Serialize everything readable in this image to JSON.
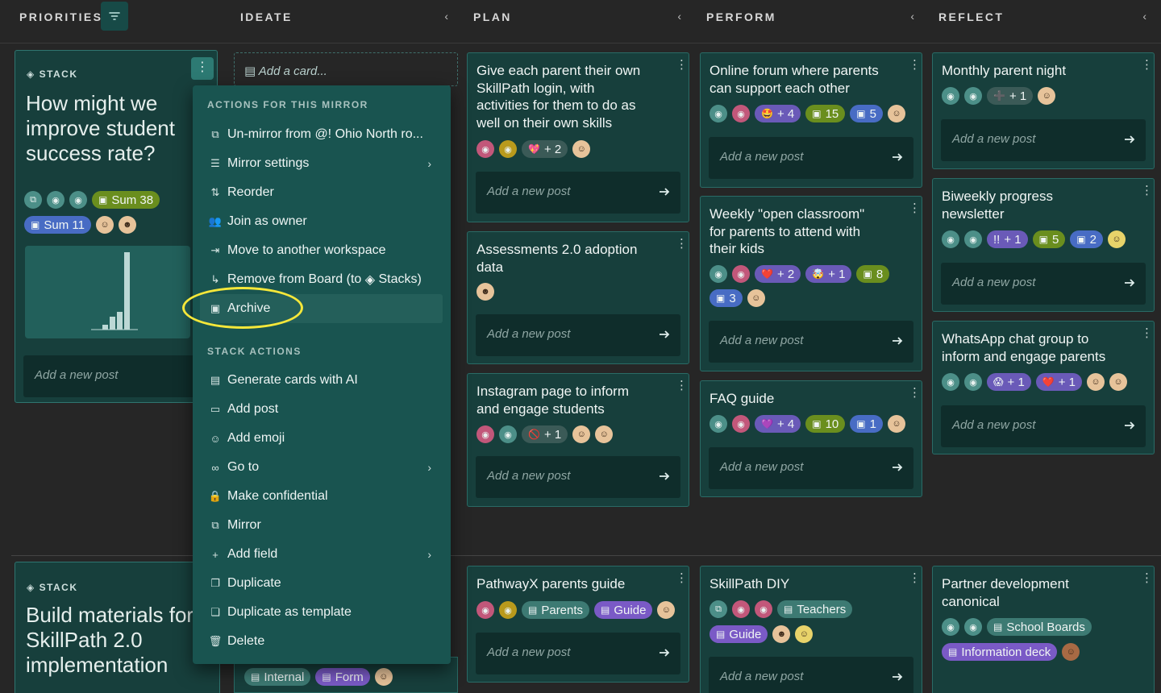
{
  "header": {
    "columns": [
      {
        "label": "PRIORITIES"
      },
      {
        "label": "IDEATE",
        "chevron": "‹"
      },
      {
        "label": "PLAN",
        "chevron": "‹"
      },
      {
        "label": "PERFORM",
        "chevron": "‹"
      },
      {
        "label": "REFLECT",
        "chevron": "‹"
      }
    ]
  },
  "stack1": {
    "label": "STACK",
    "title_line1": "How might we",
    "title_line2": "improve student",
    "title_line3": "success rate?",
    "sum1": "Sum 38",
    "sum2": "Sum 11",
    "post_placeholder": "Add a new post"
  },
  "stack2": {
    "label": "STACK",
    "title_line1": "Build materials for",
    "title_line2": "SkillPath 2.0",
    "title_line3": "implementation"
  },
  "ideate": {
    "add_card": "Add a card...",
    "tag_internal": "Internal",
    "tag_form": "Form"
  },
  "post_placeholder": "Add a new post",
  "plan": [
    {
      "title_lines": [
        "Give each parent their own",
        "SkillPath login, with",
        "activities for them to do as",
        "well on their own skills"
      ],
      "count": "+ 2"
    },
    {
      "title_lines": [
        "Assessments 2.0 adoption",
        "data"
      ]
    },
    {
      "title_lines": [
        "Instagram page to inform",
        "and engage students"
      ],
      "count": "+ 1"
    },
    {
      "title_lines": [
        "PathwayX parents guide"
      ],
      "tag1": "Parents",
      "tag2": "Guide"
    }
  ],
  "perform": [
    {
      "title_lines": [
        "Online forum where parents",
        "can support each other"
      ],
      "count": "+ 4",
      "n1": "15",
      "n2": "5"
    },
    {
      "title_lines": [
        "Weekly \"open classroom\"",
        "for parents to attend with",
        "their kids"
      ],
      "count1": "+ 2",
      "count2": "+ 1",
      "n1": "8",
      "n2": "3"
    },
    {
      "title_lines": [
        "FAQ guide"
      ],
      "count": "+ 4",
      "n1": "10",
      "n2": "1"
    },
    {
      "title_lines": [
        "SkillPath DIY"
      ],
      "tag1": "Teachers",
      "tag2": "Guide"
    }
  ],
  "reflect": [
    {
      "title_lines": [
        "Monthly parent night"
      ],
      "count": "+ 1"
    },
    {
      "title_lines": [
        "Biweekly progress",
        "newsletter"
      ],
      "bang": "!!",
      "count": "+ 1",
      "n1": "5",
      "n2": "2"
    },
    {
      "title_lines": [
        "WhatsApp chat group to",
        "inform and engage parents"
      ],
      "count1": "+ 1",
      "count2": "+ 1"
    },
    {
      "title_lines": [
        "Partner development",
        "canonical"
      ],
      "tag1": "School Boards",
      "tag2": "Information deck"
    }
  ],
  "menu": {
    "section1": "ACTIONS FOR THIS MIRROR",
    "section2": "STACK ACTIONS",
    "items1": [
      {
        "label": "Un-mirror from @! Ohio North ro...",
        "icon": "unmirror-icon"
      },
      {
        "label": "Mirror settings",
        "icon": "sliders-icon",
        "submenu": true
      },
      {
        "label": "Reorder",
        "icon": "reorder-icon"
      },
      {
        "label": "Join as owner",
        "icon": "users-icon"
      },
      {
        "label": "Move to another workspace",
        "icon": "move-icon"
      },
      {
        "label": "Remove from Board (to",
        "suffix": "Stacks)",
        "icon": "return-icon"
      },
      {
        "label": "Archive",
        "icon": "archive-icon"
      }
    ],
    "items2": [
      {
        "label": "Generate cards with AI",
        "icon": "ai-cards-icon"
      },
      {
        "label": "Add post",
        "icon": "post-icon"
      },
      {
        "label": "Add emoji",
        "icon": "emoji-icon"
      },
      {
        "label": "Go to",
        "icon": "link-icon",
        "submenu": true
      },
      {
        "label": "Make confidential",
        "icon": "lock-icon"
      },
      {
        "label": "Mirror",
        "icon": "mirror-icon"
      },
      {
        "label": "Add field",
        "icon": "plus-icon",
        "submenu": true
      },
      {
        "label": "Duplicate",
        "icon": "duplicate-icon"
      },
      {
        "label": "Duplicate as template",
        "icon": "template-icon"
      },
      {
        "label": "Delete",
        "icon": "trash-icon"
      }
    ]
  },
  "colors": {
    "card_bg": "#173f3c",
    "card_border": "#2a6b66",
    "menu_bg": "#195450",
    "highlight_ring": "#f5e73a",
    "pill_green": "#6a8e1e",
    "pill_blue": "#486cc4",
    "pill_purple": "#6a5ab8"
  }
}
